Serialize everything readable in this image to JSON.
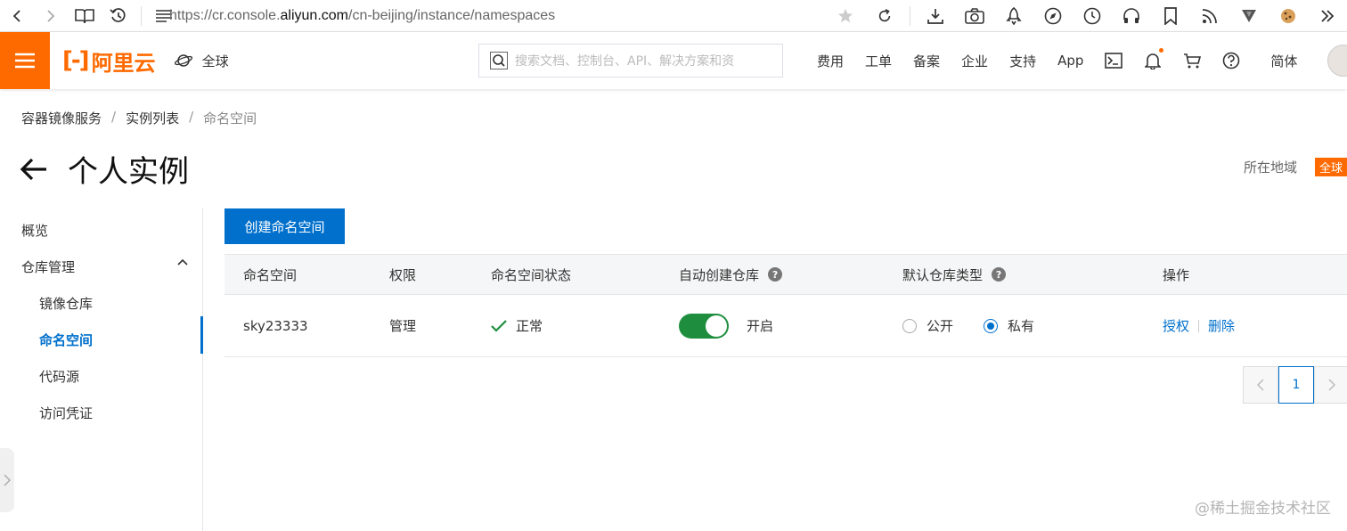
{
  "browser": {
    "url_prefix": "https://cr.console.",
    "url_domain": "aliyun.com",
    "url_path": "/cn-beijing/instance/namespaces"
  },
  "header": {
    "logo_text": "阿里云",
    "region": "全球",
    "search_placeholder": "搜索文档、控制台、API、解决方案和资",
    "nav": [
      "费用",
      "工单",
      "备案",
      "企业",
      "支持",
      "App"
    ],
    "language": "简体",
    "accent_color": "#ff6a00"
  },
  "breadcrumb": [
    "容器镜像服务",
    "实例列表",
    "命名空间"
  ],
  "page": {
    "title": "个人实例",
    "region_label": "所在地域",
    "region_tag": "全球"
  },
  "sidebar": {
    "overview": "概览",
    "repo_management": "仓库管理",
    "items": [
      "镜像仓库",
      "命名空间",
      "代码源",
      "访问凭证"
    ],
    "active_index": 1
  },
  "main": {
    "create_button": "创建命名空间",
    "columns": [
      "命名空间",
      "权限",
      "命名空间状态",
      "自动创建仓库",
      "默认仓库类型",
      "操作"
    ],
    "rows": [
      {
        "namespace": "sky23333",
        "permission": "管理",
        "status": "正常",
        "auto_create": "开启",
        "auto_create_on": true,
        "repo_type_public": "公开",
        "repo_type_private": "私有",
        "repo_type_selected": "私有",
        "action_authorize": "授权",
        "action_delete": "删除"
      }
    ],
    "pagination": {
      "current_page": "1"
    }
  },
  "watermark": "@稀土掘金技术社区",
  "colors": {
    "primary": "#0070cc",
    "success": "#1e8e3e",
    "brand": "#ff6a00"
  }
}
